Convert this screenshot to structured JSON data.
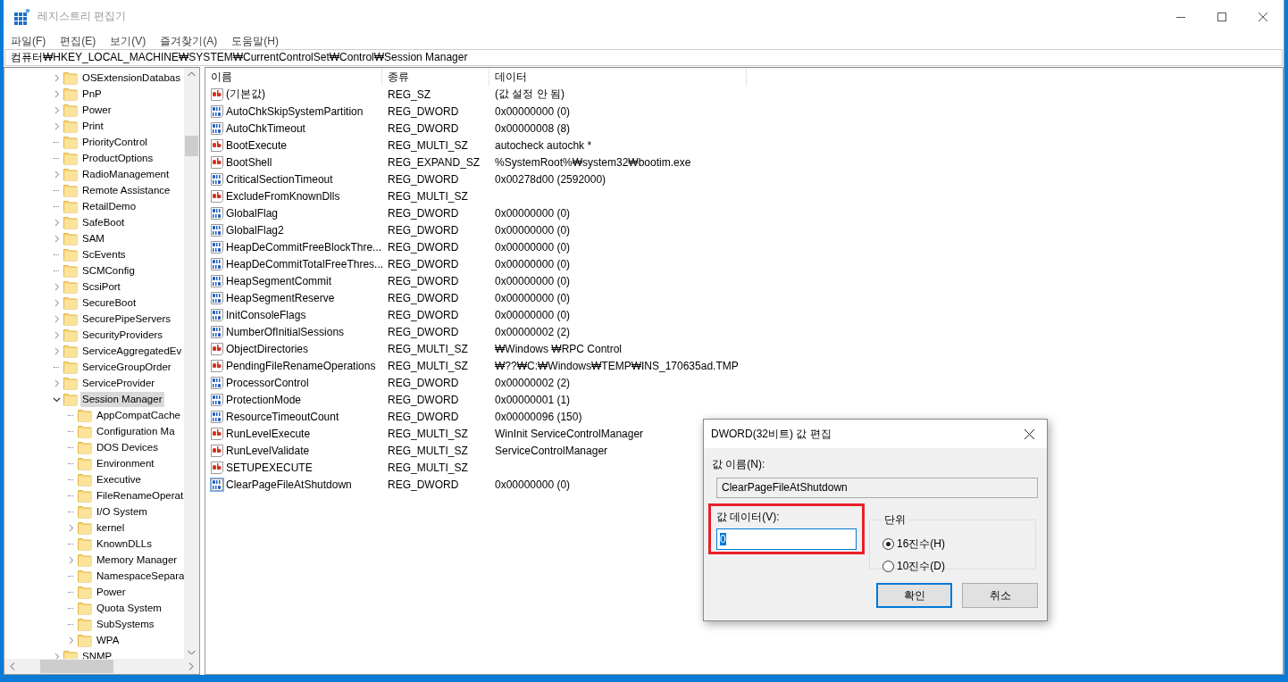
{
  "window": {
    "title": "레지스트리 편집기"
  },
  "menu": [
    "파일(F)",
    "편집(E)",
    "보기(V)",
    "즐겨찾기(A)",
    "도움말(H)"
  ],
  "address": "컴퓨터₩HKEY_LOCAL_MACHINE₩SYSTEM₩CurrentControlSet₩Control₩Session Manager",
  "tree": [
    {
      "label": "OSExtensionDatabas",
      "expanded": false,
      "selected": false
    },
    {
      "label": "PnP",
      "expanded": false,
      "selected": false
    },
    {
      "label": "Power",
      "expanded": false,
      "selected": false
    },
    {
      "label": "Print",
      "expanded": false,
      "selected": false
    },
    {
      "label": "PriorityControl",
      "selected": false
    },
    {
      "label": "ProductOptions",
      "selected": false
    },
    {
      "label": "RadioManagement",
      "expanded": false,
      "selected": false
    },
    {
      "label": "Remote Assistance",
      "selected": false
    },
    {
      "label": "RetailDemo",
      "selected": false
    },
    {
      "label": "SafeBoot",
      "expanded": false,
      "selected": false
    },
    {
      "label": "SAM",
      "expanded": false,
      "selected": false
    },
    {
      "label": "ScEvents",
      "selected": false
    },
    {
      "label": "SCMConfig",
      "selected": false
    },
    {
      "label": "ScsiPort",
      "expanded": false,
      "selected": false
    },
    {
      "label": "SecureBoot",
      "expanded": false,
      "selected": false
    },
    {
      "label": "SecurePipeServers",
      "expanded": false,
      "selected": false
    },
    {
      "label": "SecurityProviders",
      "expanded": false,
      "selected": false
    },
    {
      "label": "ServiceAggregatedEv",
      "expanded": false,
      "selected": false
    },
    {
      "label": "ServiceGroupOrder",
      "selected": false
    },
    {
      "label": "ServiceProvider",
      "expanded": false,
      "selected": false
    },
    {
      "label": "Session Manager",
      "expanded": true,
      "selected": true,
      "children": [
        {
          "label": "AppCompatCache",
          "selected": false
        },
        {
          "label": "Configuration Ma",
          "selected": false
        },
        {
          "label": "DOS Devices",
          "selected": false
        },
        {
          "label": "Environment",
          "selected": false
        },
        {
          "label": "Executive",
          "selected": false
        },
        {
          "label": "FileRenameOperat",
          "selected": false
        },
        {
          "label": "I/O System",
          "selected": false
        },
        {
          "label": "kernel",
          "expanded": false,
          "selected": false
        },
        {
          "label": "KnownDLLs",
          "selected": false
        },
        {
          "label": "Memory Manager",
          "expanded": false,
          "selected": false
        },
        {
          "label": "NamespaceSepara",
          "selected": false
        },
        {
          "label": "Power",
          "selected": false
        },
        {
          "label": "Quota System",
          "selected": false
        },
        {
          "label": "SubSystems",
          "selected": false
        },
        {
          "label": "WPA",
          "expanded": false,
          "selected": false
        }
      ]
    },
    {
      "label": "SNMP",
      "expanded": false,
      "selected": false
    }
  ],
  "table": {
    "columns": [
      "이름",
      "종류",
      "데이터"
    ],
    "rows": [
      {
        "kind": "string",
        "name": "(기본값)",
        "type": "REG_SZ",
        "data": "(값 설정 안 됨)",
        "selected": false
      },
      {
        "kind": "binary",
        "name": "AutoChkSkipSystemPartition",
        "type": "REG_DWORD",
        "data": "0x00000000 (0)",
        "selected": false
      },
      {
        "kind": "binary",
        "name": "AutoChkTimeout",
        "type": "REG_DWORD",
        "data": "0x00000008 (8)",
        "selected": false
      },
      {
        "kind": "string",
        "name": "BootExecute",
        "type": "REG_MULTI_SZ",
        "data": "autocheck autochk *",
        "selected": false
      },
      {
        "kind": "string",
        "name": "BootShell",
        "type": "REG_EXPAND_SZ",
        "data": "%SystemRoot%₩system32₩bootim.exe",
        "selected": false
      },
      {
        "kind": "binary",
        "name": "CriticalSectionTimeout",
        "type": "REG_DWORD",
        "data": "0x00278d00 (2592000)",
        "selected": false
      },
      {
        "kind": "string",
        "name": "ExcludeFromKnownDlls",
        "type": "REG_MULTI_SZ",
        "selected": false
      },
      {
        "kind": "binary",
        "name": "GlobalFlag",
        "type": "REG_DWORD",
        "data": "0x00000000 (0)",
        "selected": false
      },
      {
        "kind": "binary",
        "name": "GlobalFlag2",
        "type": "REG_DWORD",
        "data": "0x00000000 (0)",
        "selected": false
      },
      {
        "kind": "binary",
        "name": "HeapDeCommitFreeBlockThre...",
        "type": "REG_DWORD",
        "data": "0x00000000 (0)",
        "selected": false
      },
      {
        "kind": "binary",
        "name": "HeapDeCommitTotalFreeThres...",
        "type": "REG_DWORD",
        "data": "0x00000000 (0)",
        "selected": false
      },
      {
        "kind": "binary",
        "name": "HeapSegmentCommit",
        "type": "REG_DWORD",
        "data": "0x00000000 (0)",
        "selected": false
      },
      {
        "kind": "binary",
        "name": "HeapSegmentReserve",
        "type": "REG_DWORD",
        "data": "0x00000000 (0)",
        "selected": false
      },
      {
        "kind": "binary",
        "name": "InitConsoleFlags",
        "type": "REG_DWORD",
        "data": "0x00000000 (0)",
        "selected": false
      },
      {
        "kind": "binary",
        "name": "NumberOfInitialSessions",
        "type": "REG_DWORD",
        "data": "0x00000002 (2)",
        "selected": false
      },
      {
        "kind": "string",
        "name": "ObjectDirectories",
        "type": "REG_MULTI_SZ",
        "data": "₩Windows ₩RPC Control",
        "selected": false
      },
      {
        "kind": "string",
        "name": "PendingFileRenameOperations",
        "type": "REG_MULTI_SZ",
        "data": "₩??₩C:₩Windows₩TEMP₩INS_170635ad.TMP",
        "selected": false
      },
      {
        "kind": "binary",
        "name": "ProcessorControl",
        "type": "REG_DWORD",
        "data": "0x00000002 (2)",
        "selected": false
      },
      {
        "kind": "binary",
        "name": "ProtectionMode",
        "type": "REG_DWORD",
        "data": "0x00000001 (1)",
        "selected": false
      },
      {
        "kind": "binary",
        "name": "ResourceTimeoutCount",
        "type": "REG_DWORD",
        "data": "0x00000096 (150)",
        "selected": false
      },
      {
        "kind": "string",
        "name": "RunLevelExecute",
        "type": "REG_MULTI_SZ",
        "data": "WinInit ServiceControlManager",
        "selected": false
      },
      {
        "kind": "string",
        "name": "RunLevelValidate",
        "type": "REG_MULTI_SZ",
        "data": "ServiceControlManager",
        "selected": false
      },
      {
        "kind": "string",
        "name": "SETUPEXECUTE",
        "type": "REG_MULTI_SZ",
        "selected": false
      },
      {
        "kind": "binary",
        "name": "ClearPageFileAtShutdown",
        "type": "REG_DWORD",
        "data": "0x00000000 (0)",
        "selected": true
      }
    ]
  },
  "dialog": {
    "title": "DWORD(32비트) 값 편집",
    "name_label": "값 이름(N):",
    "name_value": "ClearPageFileAtShutdown",
    "data_label": "값 데이터(V):",
    "data_value": "0",
    "data_highlighted": true,
    "unit_label": "단위",
    "units": [
      {
        "label": "16진수(H)",
        "selected": true
      },
      {
        "label": "10진수(D)",
        "selected": false
      }
    ],
    "buttons": [
      {
        "label": "확인",
        "default": true
      },
      {
        "label": "취소",
        "default": false
      }
    ]
  }
}
